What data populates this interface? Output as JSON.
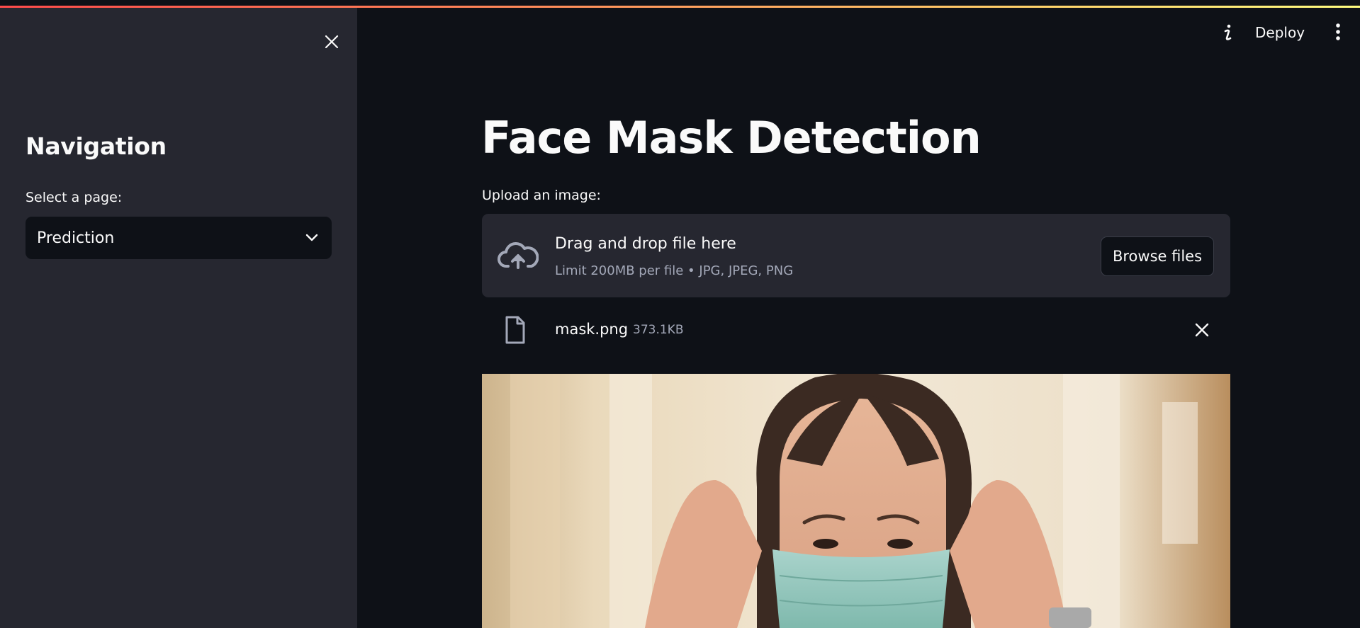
{
  "sidebar": {
    "title": "Navigation",
    "select_label": "Select a page:",
    "selected_page": "Prediction"
  },
  "header": {
    "deploy_label": "Deploy"
  },
  "main": {
    "title": "Face Mask Detection",
    "upload_label": "Upload an image:",
    "dropzone": {
      "title": "Drag and drop file here",
      "subtitle": "Limit 200MB per file • JPG, JPEG, PNG",
      "browse_label": "Browse files"
    },
    "uploaded_file": {
      "name": "mask.png",
      "size": "373.1KB"
    }
  },
  "colors": {
    "background": "#0e1117",
    "sidebar": "#262730",
    "text": "#fafafa",
    "muted": "#a3a8b8",
    "accent_gradient": [
      "#ff4b4b",
      "#fffd80"
    ]
  }
}
